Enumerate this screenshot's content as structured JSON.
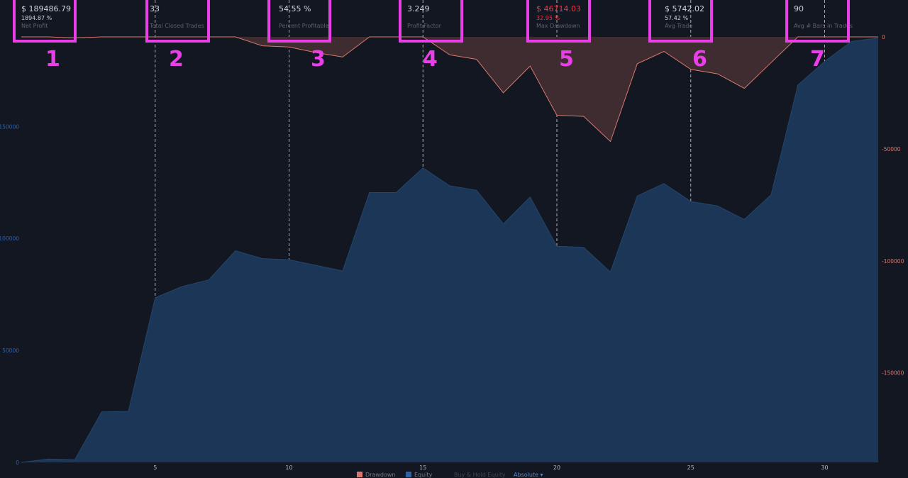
{
  "stats": [
    {
      "id": "net-profit",
      "value": "$ 189486.79",
      "sub": "1894.87 %",
      "label": "Net Profit",
      "negative": false
    },
    {
      "id": "total-closed-trades",
      "value": "33",
      "sub": "",
      "label": "Total Closed Trades",
      "negative": false
    },
    {
      "id": "percent-profitable",
      "value": "54.55 %",
      "sub": "",
      "label": "Percent Profitable",
      "negative": false
    },
    {
      "id": "profit-factor",
      "value": "3.249",
      "sub": "",
      "label": "Profit Factor",
      "negative": false
    },
    {
      "id": "max-drawdown",
      "value": "$ 46714.03",
      "sub": "32.95 %",
      "label": "Max Drawdown",
      "negative": true
    },
    {
      "id": "avg-trade",
      "value": "$ 5742.02",
      "sub": "57.42 %",
      "label": "Avg Trade",
      "negative": false
    },
    {
      "id": "avg-bars-in-trades",
      "value": "90",
      "sub": "",
      "label": "Avg # Bars in Trades",
      "negative": false
    }
  ],
  "annotations": [
    "1",
    "2",
    "3",
    "4",
    "5",
    "6",
    "7"
  ],
  "legend": [
    {
      "label": "Drawdown",
      "color": "#d9786a"
    },
    {
      "label": "Equity",
      "color": "#2962a8"
    },
    {
      "label": "Buy & Hold Equity",
      "color": ""
    },
    {
      "label": "Absolute ▾",
      "color": ""
    }
  ],
  "colors": {
    "equity_fill": "#1b3656",
    "equity_line": "#23466d",
    "drawdown_fill": "#3f2c30",
    "drawdown_line": "#d9786a",
    "annotation": "#ea3ee8",
    "left_axis_text": "#2962a8",
    "right_axis_text": "#d9786a"
  },
  "chart_data": {
    "type": "area",
    "x": [
      0,
      1,
      2,
      3,
      4,
      5,
      6,
      7,
      8,
      9,
      10,
      11,
      12,
      13,
      14,
      15,
      16,
      17,
      18,
      19,
      20,
      21,
      22,
      23,
      24,
      25,
      26,
      27,
      28,
      29,
      30,
      31,
      32
    ],
    "x_ticks": [
      5,
      10,
      15,
      20,
      25,
      30
    ],
    "xlim": [
      0,
      32
    ],
    "grid": "vertical dashed at x ticks",
    "series": [
      {
        "name": "Equity",
        "axis": "left",
        "values": [
          0,
          1500,
          1200,
          22500,
          22800,
          73500,
          78500,
          81500,
          94500,
          91000,
          90500,
          88000,
          85500,
          120500,
          120500,
          131500,
          123500,
          121500,
          106500,
          118500,
          96500,
          96000,
          85000,
          119000,
          124500,
          116500,
          114500,
          108500,
          119500,
          168500,
          179000,
          188000,
          189500
        ]
      },
      {
        "name": "Drawdown",
        "axis": "right",
        "values": [
          0,
          0,
          -500,
          0,
          0,
          0,
          0,
          0,
          0,
          -4000,
          -4500,
          -7000,
          -9000,
          0,
          0,
          0,
          -8000,
          -10000,
          -25000,
          -13000,
          -35000,
          -35500,
          -46700,
          -12000,
          -6500,
          -14500,
          -16500,
          -23000,
          -11500,
          0,
          0,
          0,
          0
        ]
      }
    ],
    "left_axis": {
      "ticks": [
        0,
        50000,
        100000,
        150000
      ],
      "ylim": [
        0,
        190000
      ]
    },
    "right_axis": {
      "ticks": [
        0,
        -50000,
        -100000,
        -150000
      ],
      "ylim": [
        -190000,
        0
      ]
    },
    "legend_placement": "bottom"
  }
}
